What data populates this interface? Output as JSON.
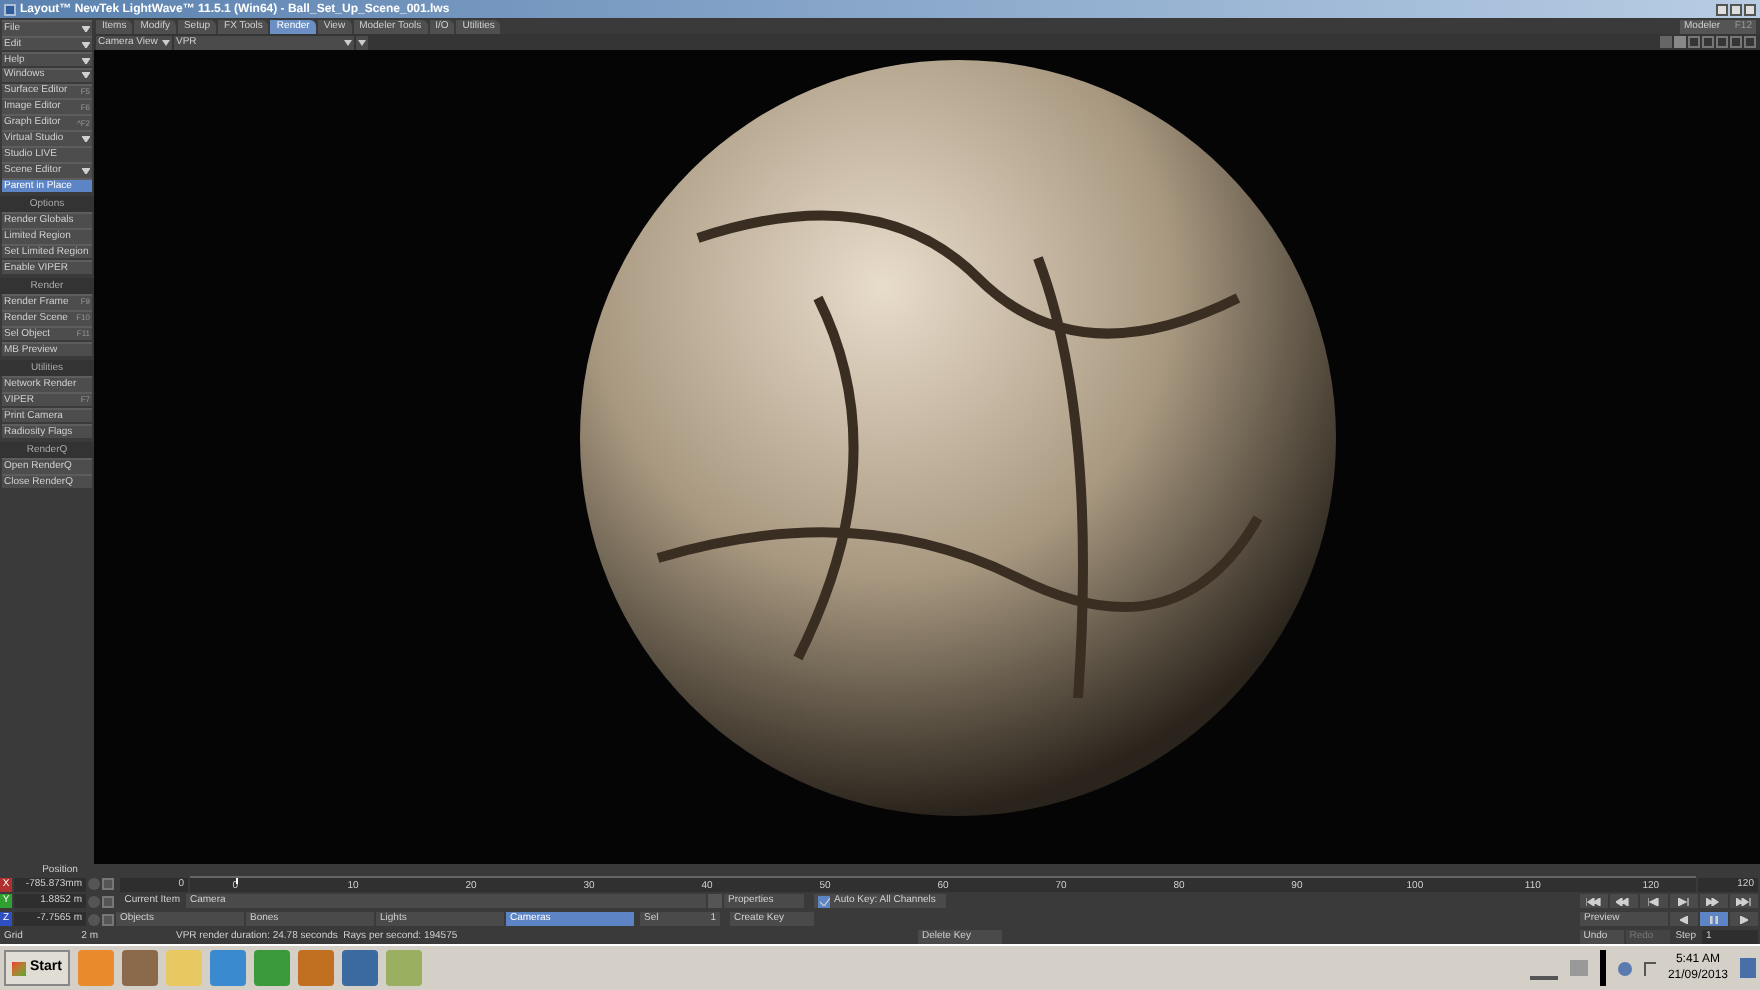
{
  "window": {
    "title": "Layout™ NewTek LightWave™ 11.5.1 (Win64) - Ball_Set_Up_Scene_001.lws"
  },
  "left_panel": [
    {
      "kind": "dropdown",
      "label": "File",
      "on": false
    },
    {
      "kind": "dropdown",
      "label": "Edit",
      "on": false
    },
    {
      "kind": "dropdown",
      "label": "Help",
      "on": false
    },
    {
      "kind": "dropdown",
      "label": "Windows",
      "on": false
    },
    {
      "kind": "button",
      "label": "Surface Editor",
      "shortcut": "F5",
      "on": false
    },
    {
      "kind": "button",
      "label": "Image Editor",
      "shortcut": "F6",
      "on": false
    },
    {
      "kind": "button",
      "label": "Graph Editor",
      "shortcut": "^F2",
      "on": false
    },
    {
      "kind": "dropdown",
      "label": "Virtual Studio",
      "on": false
    },
    {
      "kind": "button",
      "label": "Studio LIVE",
      "on": false
    },
    {
      "kind": "dropdown",
      "label": "Scene Editor",
      "on": false
    },
    {
      "kind": "button",
      "label": "Parent in Place",
      "on": true
    },
    {
      "kind": "header",
      "label": "Options"
    },
    {
      "kind": "button",
      "label": "Render Globals",
      "on": false
    },
    {
      "kind": "button",
      "label": "Limited Region",
      "on": false
    },
    {
      "kind": "button",
      "label": "Set Limited Region",
      "on": false
    },
    {
      "kind": "button",
      "label": "Enable VIPER",
      "on": false
    },
    {
      "kind": "header",
      "label": "Render"
    },
    {
      "kind": "button",
      "label": "Render Frame",
      "shortcut": "F9",
      "on": false
    },
    {
      "kind": "button",
      "label": "Render Scene",
      "shortcut": "F10",
      "on": false
    },
    {
      "kind": "button",
      "label": "Sel Object",
      "shortcut": "F11",
      "on": false
    },
    {
      "kind": "button",
      "label": "MB Preview",
      "on": false
    },
    {
      "kind": "header",
      "label": "Utilities"
    },
    {
      "kind": "button",
      "label": "Network Render",
      "on": false
    },
    {
      "kind": "button",
      "label": "VIPER",
      "shortcut": "F7",
      "on": false
    },
    {
      "kind": "button",
      "label": "Print Camera",
      "on": false
    },
    {
      "kind": "button",
      "label": "Radiosity Flags",
      "on": false
    },
    {
      "kind": "header",
      "label": "RenderQ"
    },
    {
      "kind": "button",
      "label": "Open RenderQ",
      "on": false
    },
    {
      "kind": "button",
      "label": "Close RenderQ",
      "on": false
    }
  ],
  "tabs": [
    {
      "label": "Items",
      "selected": false
    },
    {
      "label": "Modify",
      "selected": false
    },
    {
      "label": "Setup",
      "selected": false
    },
    {
      "label": "FX Tools",
      "selected": false
    },
    {
      "label": "Render",
      "selected": true
    },
    {
      "label": "View",
      "selected": false
    },
    {
      "label": "Modeler Tools",
      "selected": false
    },
    {
      "label": "I/O",
      "selected": false
    },
    {
      "label": "Utilities",
      "selected": false
    }
  ],
  "toolbar": {
    "view": "Camera View",
    "mode": "VPR"
  },
  "modeler_button": {
    "label": "Modeler",
    "shortcut": "F12"
  },
  "bottom": {
    "position": {
      "label": "Position",
      "fields": [
        {
          "axis": "X",
          "value": "-785.873mm"
        },
        {
          "axis": "Y",
          "value": "1.8852 m"
        },
        {
          "axis": "Z",
          "value": "-7.7565 m"
        }
      ]
    },
    "grid": {
      "label": "Grid",
      "value": "2 m"
    },
    "timeline": {
      "start_frame": "0",
      "ticks": [
        "0",
        "10",
        "20",
        "30",
        "40",
        "50",
        "60",
        "70",
        "80",
        "90",
        "100",
        "110",
        "120"
      ],
      "end_frame": "120"
    },
    "current_item": {
      "label": "Current Item",
      "value": "Camera"
    },
    "properties": "Properties",
    "item_types": [
      {
        "label": "Objects",
        "selected": false
      },
      {
        "label": "Bones",
        "selected": false
      },
      {
        "label": "Lights",
        "selected": false
      },
      {
        "label": "Cameras",
        "selected": true
      }
    ],
    "sel": {
      "label": "Sel",
      "value": "1"
    },
    "auto_key": {
      "label": "Auto Key: All Channels",
      "checked": true
    },
    "create_key": "Create Key",
    "delete_key": "Delete Key",
    "status": "VPR render duration: 24.78 seconds  Rays per second: 194575",
    "transport": [
      {
        "kind": "first",
        "selected": false
      },
      {
        "kind": "prev-key",
        "selected": false
      },
      {
        "kind": "prev",
        "selected": false
      },
      {
        "kind": "next",
        "selected": false
      },
      {
        "kind": "next-key",
        "selected": false
      },
      {
        "kind": "last",
        "selected": false
      }
    ],
    "preview": "Preview",
    "play": [
      {
        "kind": "reverse",
        "selected": false
      },
      {
        "kind": "pause",
        "selected": true
      },
      {
        "kind": "play",
        "selected": false
      }
    ],
    "undo": "Undo",
    "redo": "Redo",
    "step": {
      "label": "Step",
      "value": "1"
    }
  },
  "taskbar": {
    "start": "Start",
    "time": "5:41 AM",
    "date": "21/09/2013"
  }
}
